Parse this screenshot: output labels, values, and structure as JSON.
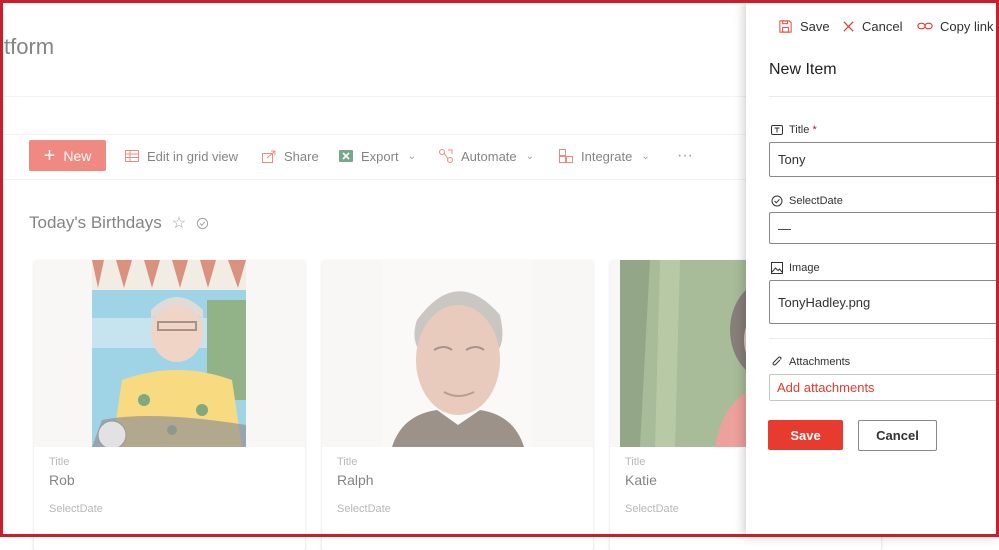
{
  "site": {
    "title": "tform"
  },
  "commandbar": {
    "new_label": "New",
    "edit_grid_label": "Edit in grid view",
    "share_label": "Share",
    "export_label": "Export",
    "automate_label": "Automate",
    "integrate_label": "Integrate",
    "more_label": "···"
  },
  "section": {
    "title": "Today's Birthdays"
  },
  "cards": [
    {
      "title_label": "Title",
      "title": "Rob",
      "date_label": "SelectDate"
    },
    {
      "title_label": "Title",
      "title": "Ralph",
      "date_label": "SelectDate"
    },
    {
      "title_label": "Title",
      "title": "Katie",
      "date_label": "SelectDate"
    }
  ],
  "panel": {
    "save_label": "Save",
    "cancel_label": "Cancel",
    "copy_link_label": "Copy link",
    "heading": "New Item",
    "title_field": {
      "label": "Title",
      "required_mark": "*",
      "value": "Tony"
    },
    "date_field": {
      "label": "SelectDate",
      "value": "—"
    },
    "image_field": {
      "label": "Image",
      "value": "TonyHadley.png"
    },
    "attachments": {
      "label": "Attachments",
      "add_label": "Add attachments"
    },
    "footer": {
      "save_label": "Save",
      "cancel_label": "Cancel"
    }
  },
  "colors": {
    "accent": "#e63b2e",
    "frame": "#c8202a"
  }
}
